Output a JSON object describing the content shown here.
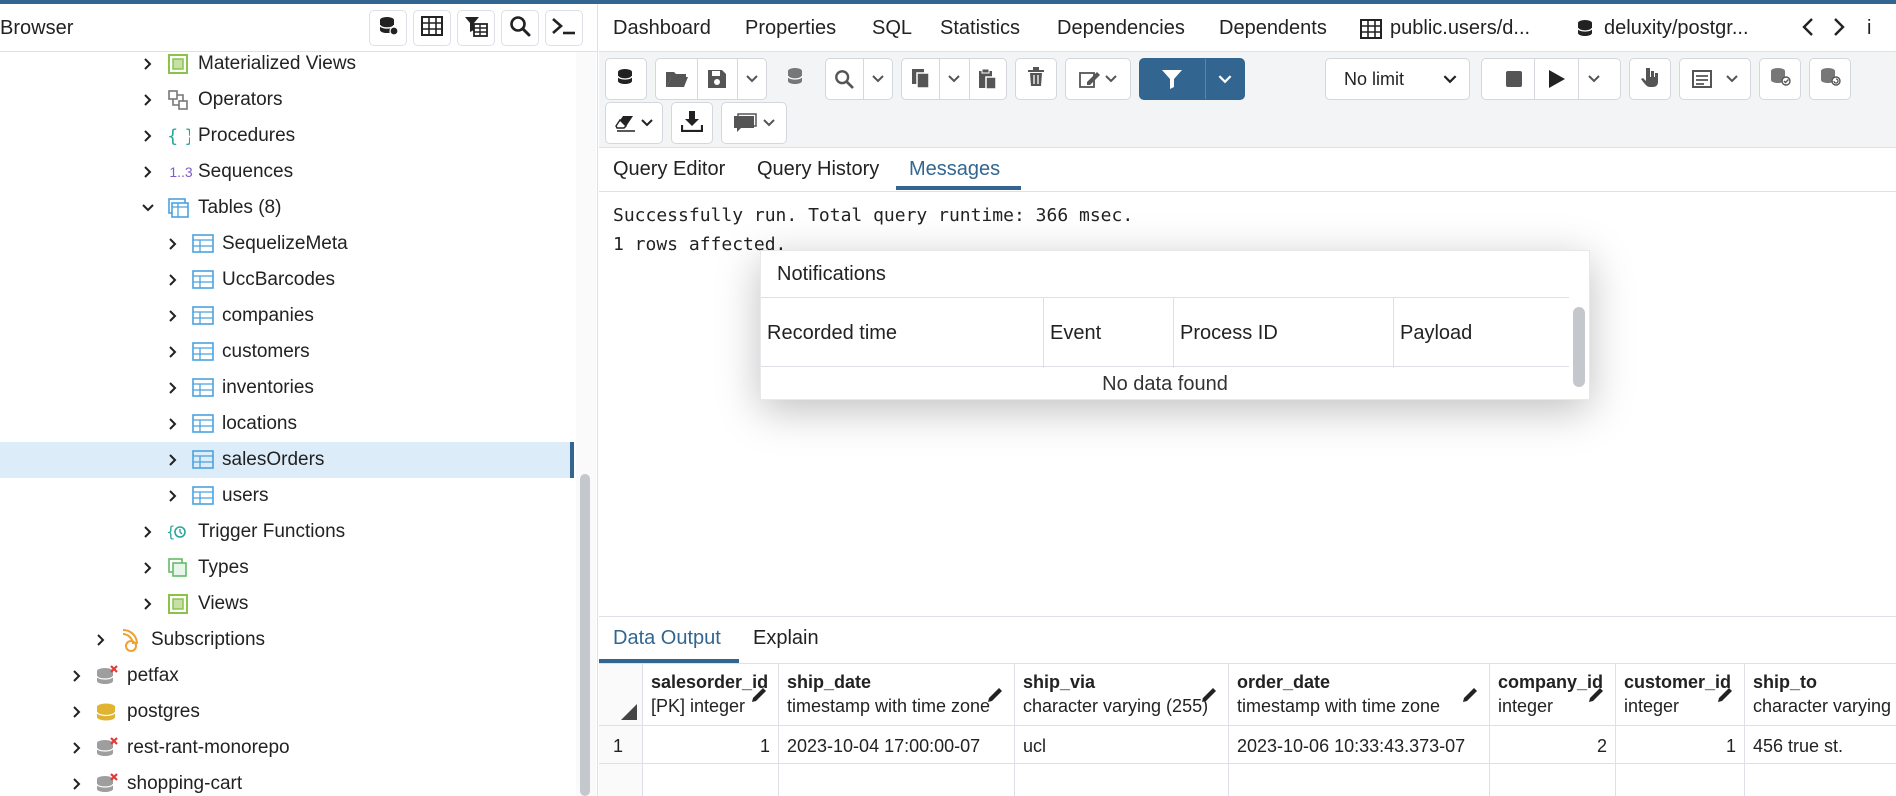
{
  "colors": {
    "accent": "#326690",
    "selected_bg": "#dcecf9",
    "border": "#dde0e6",
    "toolbar_bg": "#f3f4f6"
  },
  "browser": {
    "title": "Browser",
    "toolbar_icons": [
      "database-icon",
      "table-grid-icon",
      "filter-table-icon",
      "search-icon",
      "terminal-icon"
    ],
    "tree": [
      {
        "label": "Materialized Views",
        "icon": "materialized-view-icon",
        "expanded": false
      },
      {
        "label": "Operators",
        "icon": "operators-icon",
        "expanded": false
      },
      {
        "label": "Procedures",
        "icon": "procedure-icon",
        "expanded": false
      },
      {
        "label": "Sequences",
        "icon": "sequence-icon",
        "icon_text": "1..3",
        "expanded": false
      },
      {
        "label": "Tables (8)",
        "icon": "tables-icon",
        "expanded": true
      },
      {
        "label": "SequelizeMeta",
        "icon": "table-icon"
      },
      {
        "label": "UccBarcodes",
        "icon": "table-icon"
      },
      {
        "label": "companies",
        "icon": "table-icon"
      },
      {
        "label": "customers",
        "icon": "table-icon"
      },
      {
        "label": "inventories",
        "icon": "table-icon"
      },
      {
        "label": "locations",
        "icon": "table-icon"
      },
      {
        "label": "salesOrders",
        "icon": "table-icon",
        "selected": true
      },
      {
        "label": "users",
        "icon": "table-icon"
      },
      {
        "label": "Trigger Functions",
        "icon": "trigger-function-icon",
        "expanded": false
      },
      {
        "label": "Types",
        "icon": "types-icon",
        "expanded": false
      },
      {
        "label": "Views",
        "icon": "views-icon",
        "expanded": false
      },
      {
        "label": "Subscriptions",
        "icon": "subscriptions-icon",
        "expanded": false
      },
      {
        "label": "petfax",
        "icon": "database-disconnected-icon"
      },
      {
        "label": "postgres",
        "icon": "database-icon"
      },
      {
        "label": "rest-rant-monorepo",
        "icon": "database-disconnected-icon"
      },
      {
        "label": "shopping-cart",
        "icon": "database-disconnected-icon"
      }
    ]
  },
  "tabs": {
    "items": [
      "Dashboard",
      "Properties",
      "SQL",
      "Statistics",
      "Dependencies",
      "Dependents",
      "public.users/d...",
      "deluxity/postgr...",
      "i"
    ]
  },
  "toolbar": {
    "limit_value": "No limit"
  },
  "query_tabs": [
    "Query Editor",
    "Query History",
    "Messages"
  ],
  "active_query_tab": "Messages",
  "messages": [
    "Successfully run. Total query runtime: 366 msec.",
    "1 rows affected."
  ],
  "notifications": {
    "title": "Notifications",
    "columns": [
      "Recorded time",
      "Event",
      "Process ID",
      "Payload"
    ],
    "empty_text": "No data found"
  },
  "output_tabs": [
    "Data Output",
    "Explain"
  ],
  "active_output_tab": "Data Output",
  "grid": {
    "columns": [
      {
        "name": "salesorder_id",
        "type": "[PK] integer"
      },
      {
        "name": "ship_date",
        "type": "timestamp with time zone"
      },
      {
        "name": "ship_via",
        "type": "character varying (255)"
      },
      {
        "name": "order_date",
        "type": "timestamp with time zone"
      },
      {
        "name": "company_id",
        "type": "integer"
      },
      {
        "name": "customer_id",
        "type": "integer"
      },
      {
        "name": "ship_to",
        "type": "character varying"
      }
    ],
    "rows": [
      {
        "row_num": "1",
        "cells": [
          "1",
          "2023-10-04 17:00:00-07",
          "ucl",
          "2023-10-06 10:33:43.373-07",
          "2",
          "1",
          "456 true st."
        ]
      }
    ]
  }
}
